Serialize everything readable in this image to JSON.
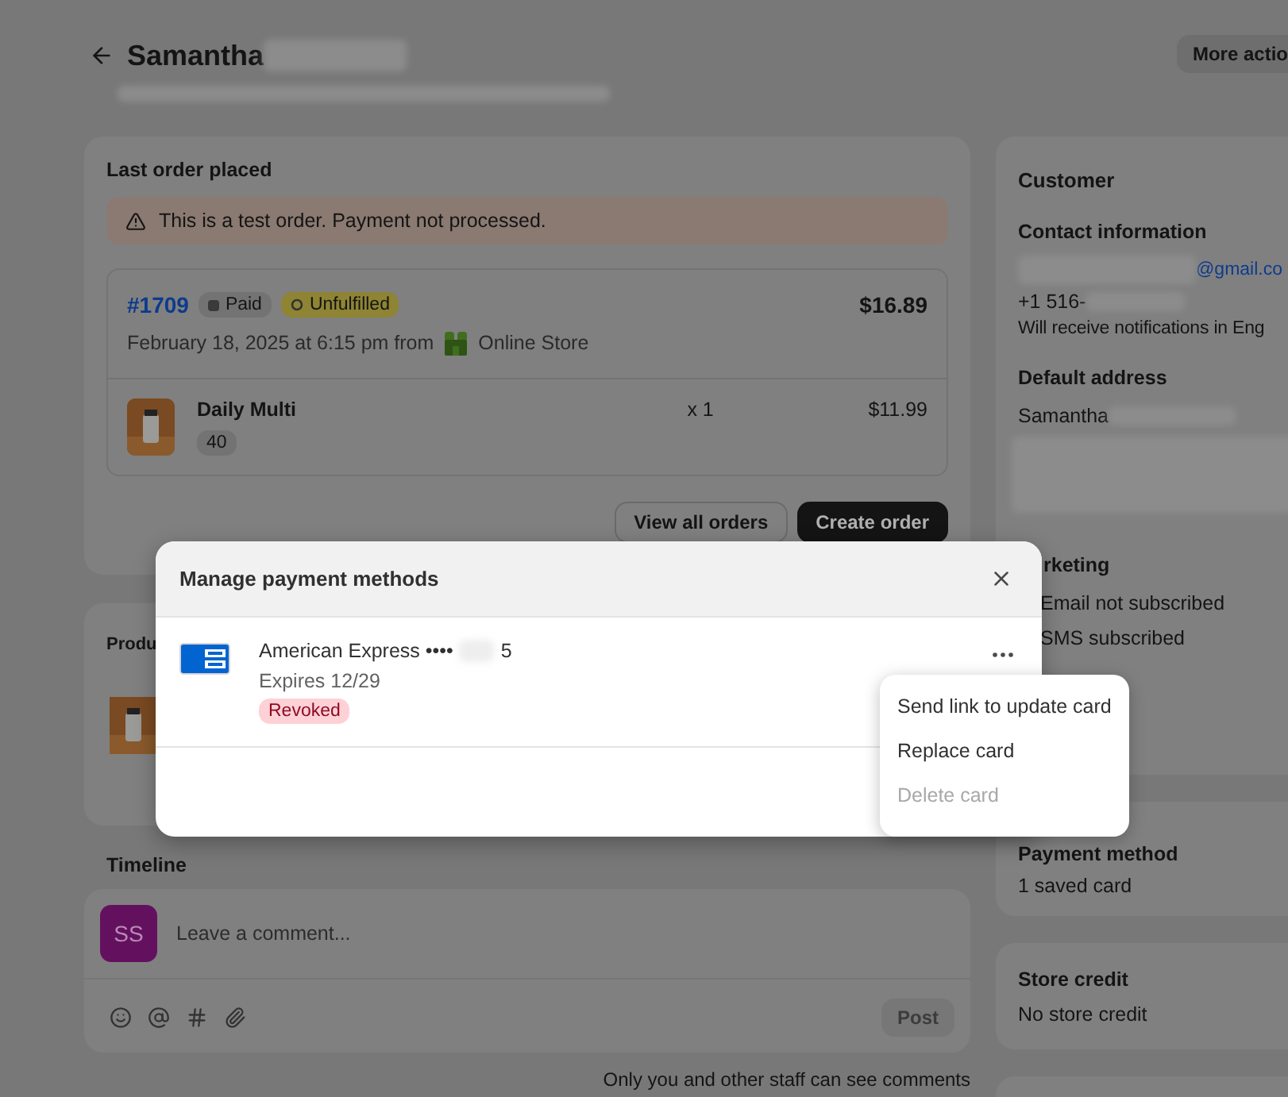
{
  "header": {
    "title": "Samantha",
    "more_button": "More actio"
  },
  "last_order": {
    "title": "Last order placed",
    "banner": "This is a test order. Payment not processed.",
    "order": {
      "number": "#1709",
      "payment_badge": "Paid",
      "fulfillment_badge": "Unfulfilled",
      "total": "$16.89",
      "date": "February 18, 2025 at 6:15 pm from",
      "channel": "Online Store",
      "items": [
        {
          "name": "Daily Multi",
          "variant": "40",
          "quantity": "x 1",
          "price": "$11.99"
        }
      ]
    },
    "buttons": [
      {
        "label": "View all orders",
        "primary": false
      },
      {
        "label": "Create order",
        "primary": true
      }
    ]
  },
  "products": {
    "title": "Produ"
  },
  "timeline": {
    "title": "Timeline",
    "avatar": "SS",
    "comment_placeholder": "Leave a comment...",
    "post_button": "Post",
    "note": "Only you and other staff can see comments"
  },
  "customer": {
    "title": "Customer",
    "contact_heading": "Contact information",
    "email": "@gmail.co",
    "phone": "+1 516-",
    "notifications": "Will receive notifications in Eng",
    "address_heading": "Default address",
    "address_name": "Samantha",
    "marketing_heading": "rketing",
    "marketing": [
      "Email not subscribed",
      "SMS subscribed"
    ]
  },
  "payment_method": {
    "title": "Payment method",
    "value": "1 saved card"
  },
  "store_credit": {
    "title": "Store credit",
    "value": "No store credit"
  },
  "modal": {
    "title": "Manage payment methods",
    "card": {
      "brand": "American Express ••••",
      "last_digit": "5",
      "expires": "Expires 12/29",
      "status": "Revoked"
    },
    "menu": [
      {
        "label": "Send link to update card",
        "disabled": false
      },
      {
        "label": "Replace card",
        "disabled": false
      },
      {
        "label": "Delete card",
        "disabled": true
      }
    ]
  }
}
